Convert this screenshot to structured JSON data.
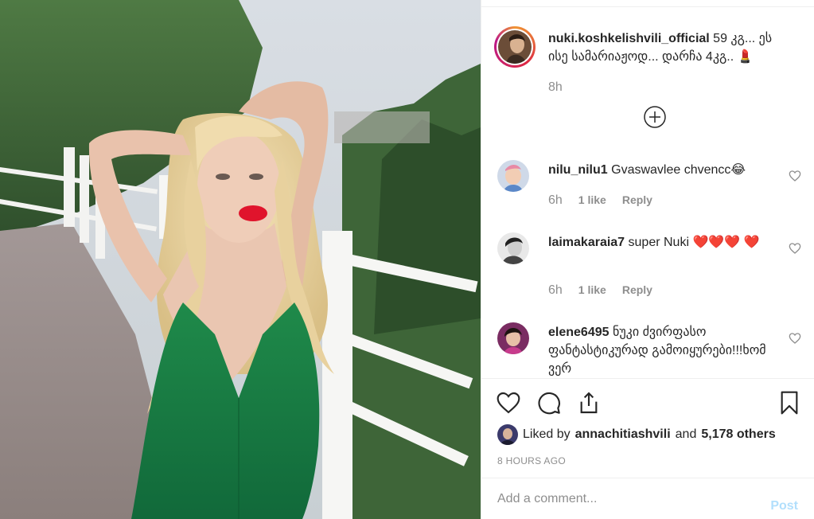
{
  "caption": {
    "username": "nuki.koshkelishvili_official",
    "text": " 59 კგ... ეს ისე სამარიაჟოდ... დარჩა 4კგ.. 💄",
    "time": "8h"
  },
  "comments": [
    {
      "username": "nilu_nilu1",
      "text": " Gvaswavlee chvencc😂",
      "time": "6h",
      "likes": "1 like",
      "reply": "Reply"
    },
    {
      "username": "laimakaraia7",
      "text": " super Nuki ❤️❤️❤️ ❤️",
      "time": "6h",
      "likes": "1 like",
      "reply": "Reply"
    },
    {
      "username": "elene6495",
      "text": " ნუკი ძვირფასო ფანტასტიკურად გამოიყურები!!!ხომ ვერ"
    }
  ],
  "liked": {
    "prefix": "Liked by",
    "user": "annachitiashvili",
    "and": "and",
    "others": "5,178 others"
  },
  "post_time": "8 HOURS AGO",
  "add_comment": {
    "placeholder": "Add a comment...",
    "post_label": "Post"
  },
  "icons": {
    "like": "heart-icon",
    "comment": "comment-icon",
    "share": "share-icon",
    "save": "bookmark-icon",
    "load_more": "plus-circle-icon"
  }
}
